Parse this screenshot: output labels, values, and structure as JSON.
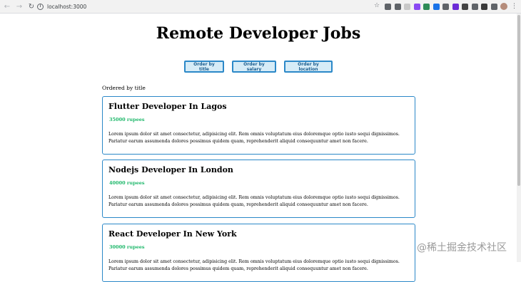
{
  "browser": {
    "url": "localhost:3000",
    "icons": [
      "back-icon",
      "forward-icon",
      "reload-icon",
      "info-icon",
      "star-icon",
      "menu-icon"
    ],
    "extension_colors": [
      "#5f6368",
      "#5f6368",
      "#c8c8c8",
      "#8a4af3",
      "#2e8b57",
      "#1a73e8",
      "#5f6368",
      "#6b2bd6",
      "#444444",
      "#5f6368",
      "#3a3a3a",
      "#5f6368"
    ]
  },
  "page": {
    "title": "Remote Developer Jobs",
    "buttons": [
      {
        "label": "Order by title"
      },
      {
        "label": "Order by salary"
      },
      {
        "label": "Order by location"
      }
    ],
    "ordered_by": "Ordered by title",
    "jobs": [
      {
        "title": "Flutter Developer In Lagos",
        "salary": "35000 rupees",
        "description": "Lorem ipsum dolor sit amet consectetur, adipisicing elit. Rem omnis voluptatum eius doloremque optio iusto sequi dignissimos. Pariatur earum assumenda dolores possimus quidem quam, reprehenderit aliquid consequuntur amet non facere."
      },
      {
        "title": "Nodejs Developer In London",
        "salary": "40000 rupees",
        "description": "Lorem ipsum dolor sit amet consectetur, adipisicing elit. Rem omnis voluptatum eius doloremque optio iusto sequi dignissimos. Pariatur earum assumenda dolores possimus quidem quam, reprehenderit aliquid consequuntur amet non facere."
      },
      {
        "title": "React Developer In New York",
        "salary": "30000 rupees",
        "description": "Lorem ipsum dolor sit amet consectetur, adipisicing elit. Rem omnis voluptatum eius doloremque optio iusto sequi dignissimos. Pariatur earum assumenda dolores possimus quidem quam, reprehenderit aliquid consequuntur amet non facere."
      }
    ]
  },
  "colors": {
    "accent_border": "#2b88c8",
    "button_bg": "#d6ecf7",
    "salary_green": "#1fb86b"
  },
  "watermark": "@稀土掘金技术社区"
}
